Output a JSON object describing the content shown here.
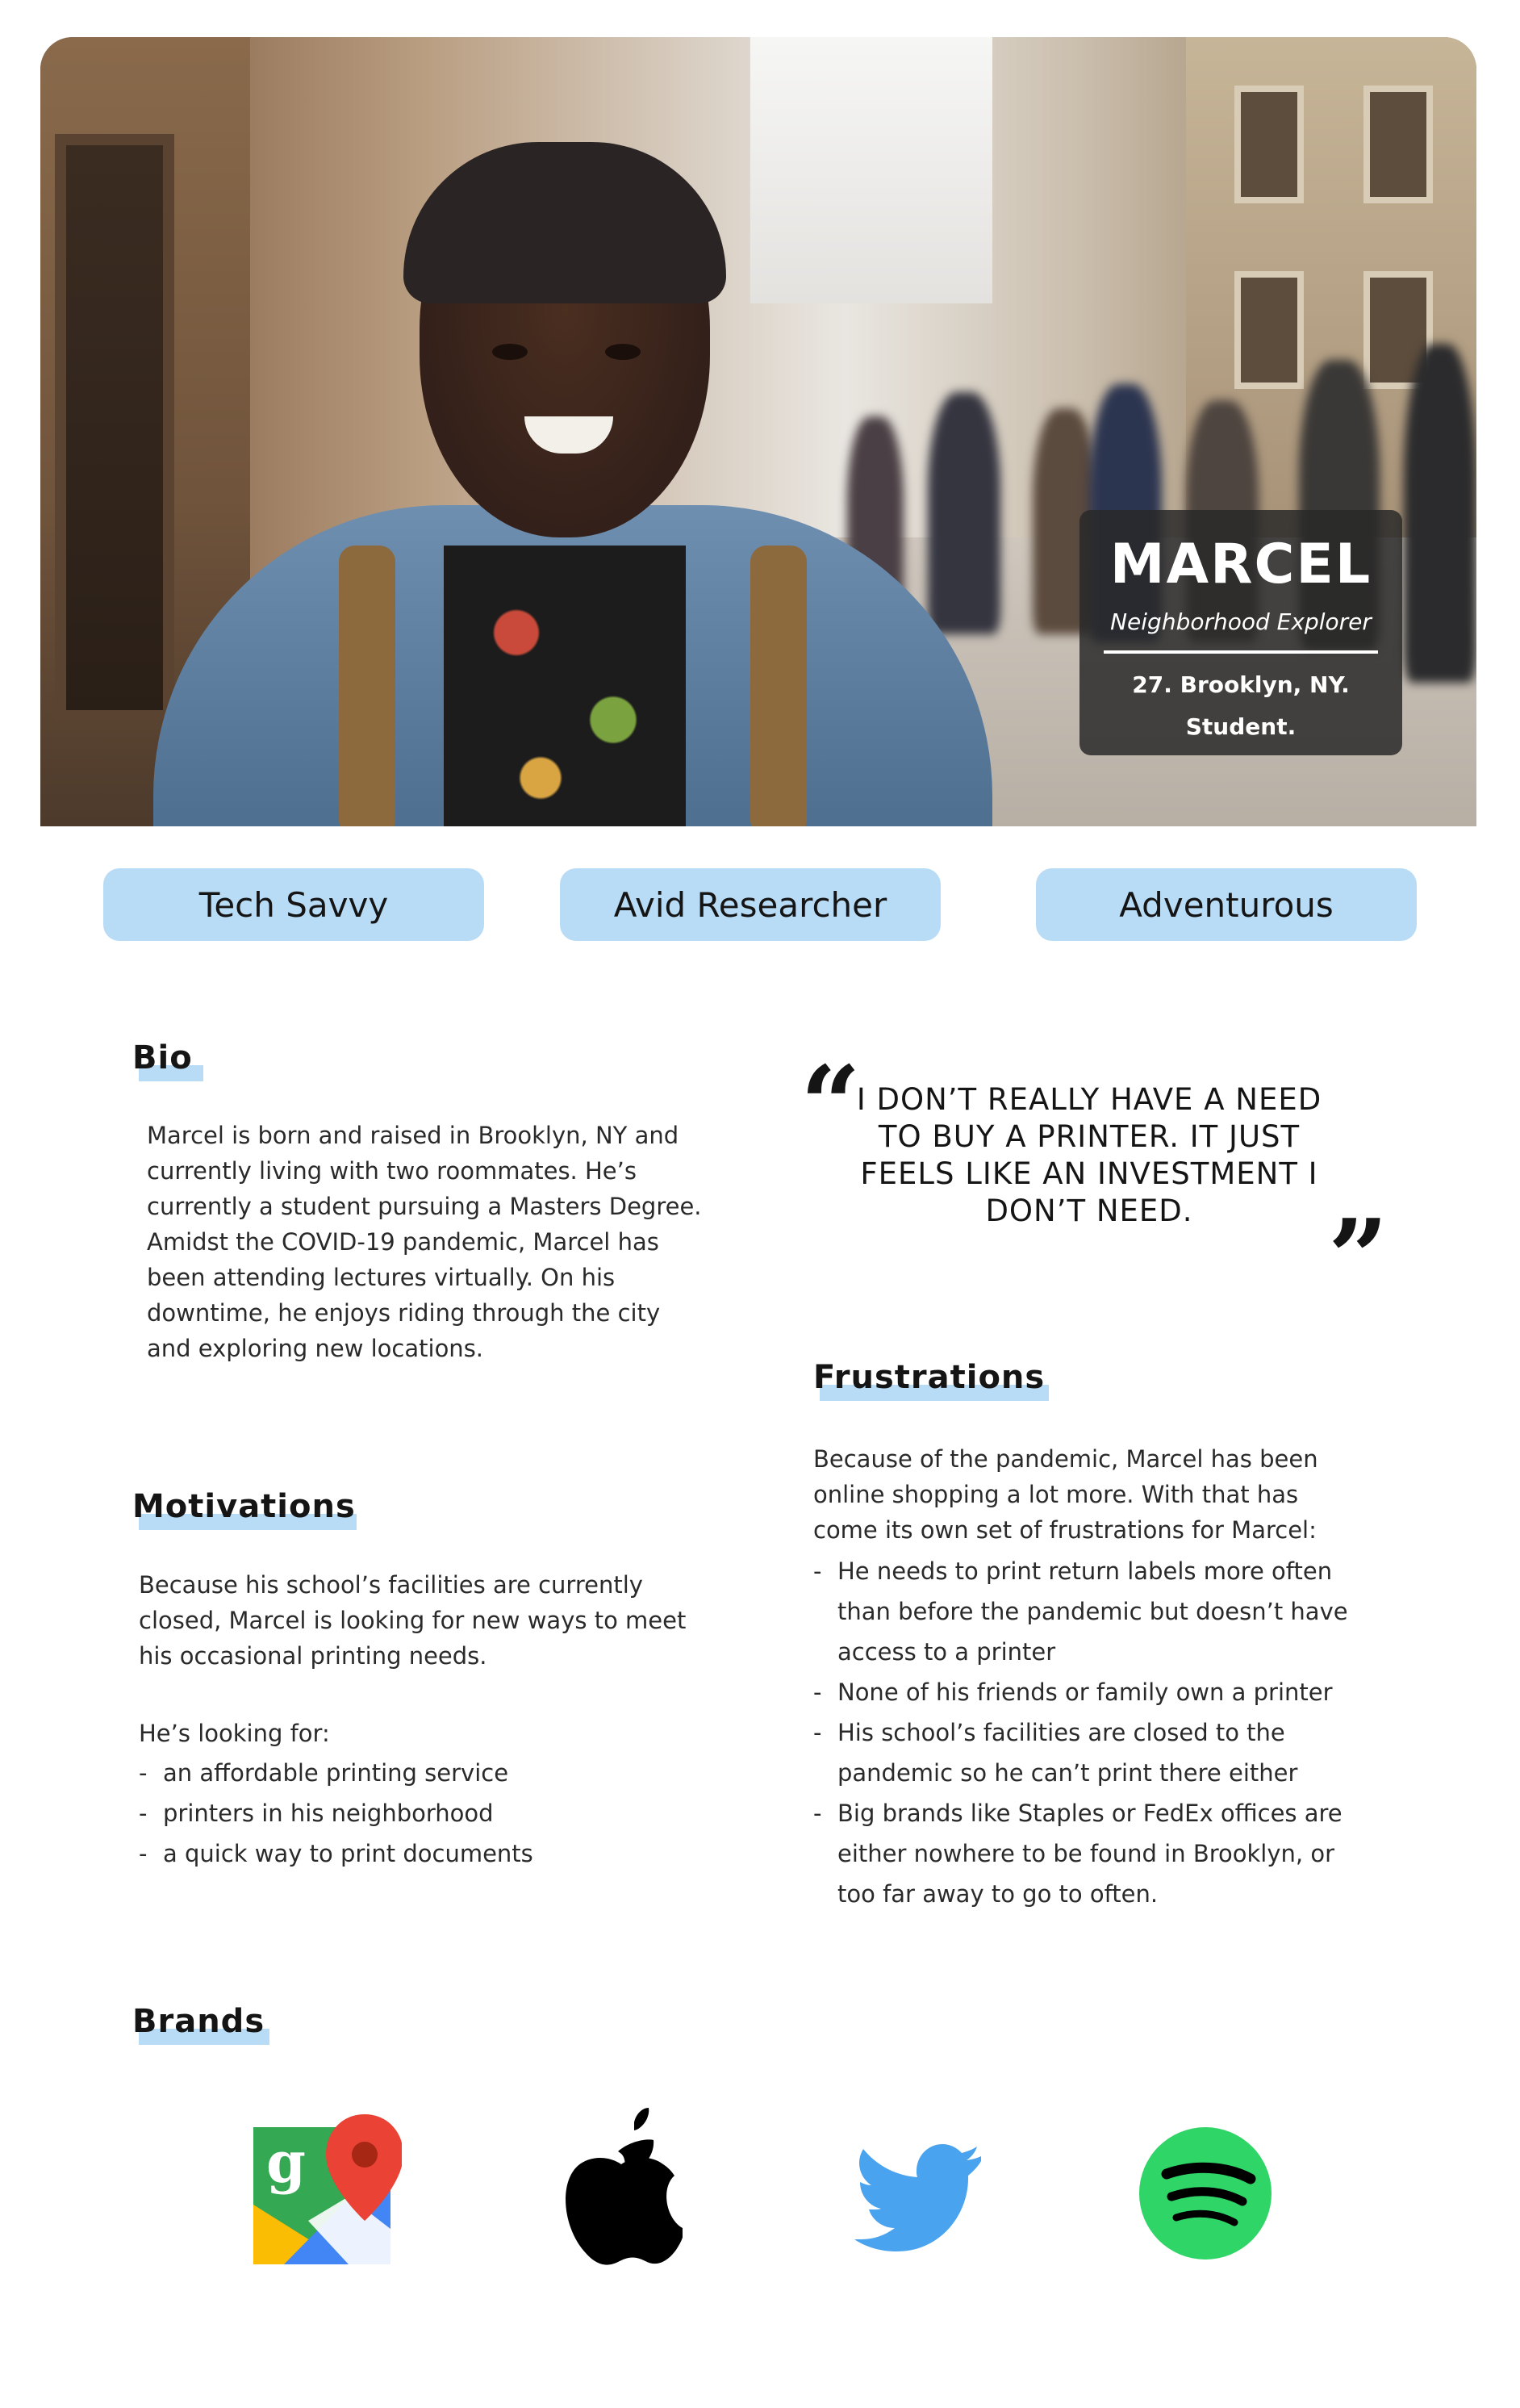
{
  "profile": {
    "name": "MARCEL",
    "role": "Neighborhood Explorer",
    "meta_line1": "27. Brooklyn, NY.",
    "meta_line2": "Student."
  },
  "traits": [
    "Tech Savvy",
    "Avid Researcher",
    "Adventurous"
  ],
  "bio": {
    "heading": "Bio",
    "text": "Marcel is born and raised in Brooklyn, NY and currently living with two roommates. He’s currently a student pursuing a Masters Degree. Amidst the COVID-19 pandemic, Marcel has been attending lectures virtually. On his downtime, he enjoys riding through the city and exploring new locations."
  },
  "quote": {
    "text": "I DON’T REALLY HAVE A NEED TO BUY A PRINTER. IT JUST FEELS LIKE AN INVESTMENT I DON’T NEED."
  },
  "motivations": {
    "heading": "Motivations",
    "text": "Because his school’s facilities are currently closed, Marcel is looking for new ways to meet his occasional printing needs.",
    "list_intro": "He’s looking for:",
    "items": [
      "an affordable printing service",
      "printers in his neighborhood",
      "a quick way to print documents"
    ]
  },
  "frustrations": {
    "heading": "Frustrations",
    "text": "Because of the pandemic, Marcel has been online shopping a lot more. With that has come its own set of frustrations for Marcel:",
    "items": [
      "He needs to print return labels more often than before the pandemic but doesn’t have access to a printer",
      "None of his friends or family own a printer",
      "His school’s facilities are closed to the pandemic so he can’t print there either",
      "Big brands like Staples or FedEx offices are either nowhere to be found in Brooklyn, or too far away to go to often."
    ]
  },
  "brands": {
    "heading": "Brands",
    "logos": [
      "google-maps-icon",
      "apple-icon",
      "twitter-icon",
      "spotify-icon"
    ]
  },
  "colors": {
    "accent": "#b9dcf6",
    "text": "#151515",
    "card": "#2f2f2f"
  }
}
